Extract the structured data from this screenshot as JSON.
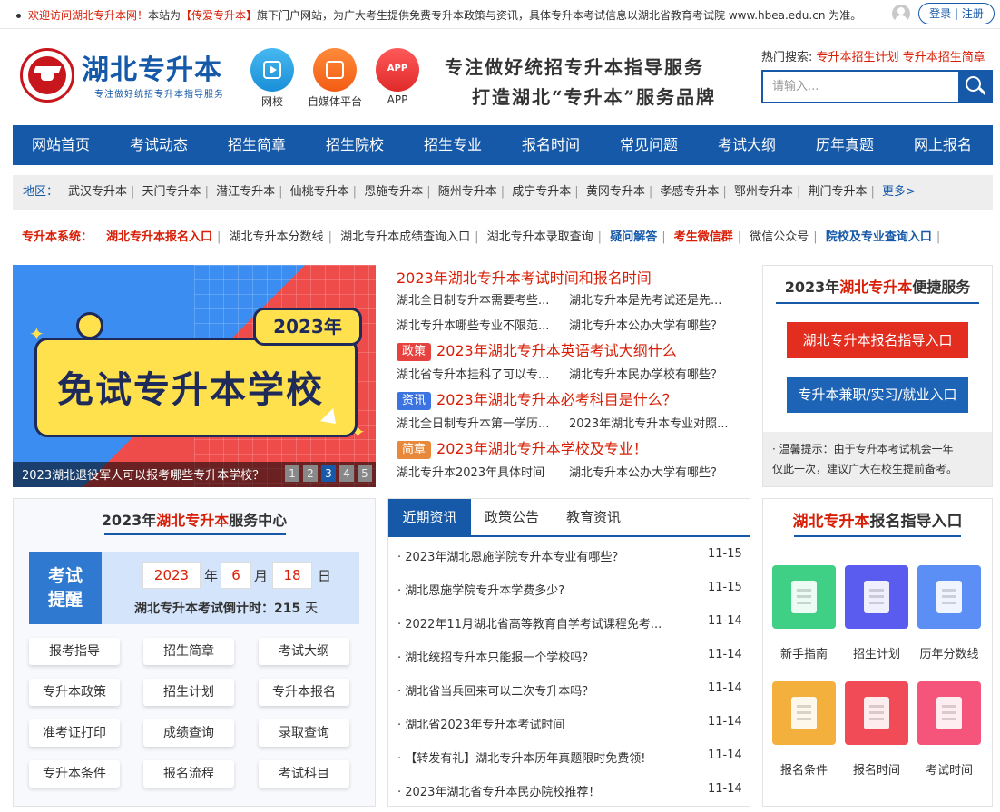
{
  "topbar": {
    "welcome_prefix": "欢迎访问湖北专升本网！",
    "welcome_mid1": "本站为",
    "welcome_brand": "【传爱专升本】",
    "welcome_rest": "旗下门户网站，为广大考生提供免费专升本政策与资讯，具体专升本考试信息以湖北省教育考试院 www.hbea.edu.cn 为准。",
    "login": "登录 | 注册"
  },
  "header": {
    "logo_title": "湖北专升本",
    "logo_subtitle": "专注做好统招专升本指导服务",
    "apps": [
      {
        "label": "网校"
      },
      {
        "label": "自媒体平台"
      },
      {
        "label": "APP",
        "icon_text": "APP"
      }
    ],
    "slogan1": "专注做好统招专升本指导服务",
    "slogan2": "打造湖北“专升本”服务品牌",
    "hot_label": "热门搜索:",
    "hot1": "专升本招生计划",
    "hot2": "专升本招生简章",
    "search_placeholder": "请输入..."
  },
  "nav": [
    "网站首页",
    "考试动态",
    "招生简章",
    "招生院校",
    "招生专业",
    "报名时间",
    "常见问题",
    "考试大纲",
    "历年真题",
    "网上报名"
  ],
  "region": {
    "label": "地区：",
    "items": [
      "武汉专升本",
      "天门专升本",
      "潜江专升本",
      "仙桃专升本",
      "恩施专升本",
      "随州专升本",
      "咸宁专升本",
      "黄冈专升本",
      "孝感专升本",
      "鄂州专升本",
      "荆门专升本"
    ],
    "more": "更多>"
  },
  "system": {
    "label": "专升本系统：",
    "items": [
      {
        "text": "湖北专升本报名入口",
        "style": "red"
      },
      {
        "text": "湖北专升本分数线",
        "style": "norm"
      },
      {
        "text": "湖北专升本成绩查询入口",
        "style": "norm"
      },
      {
        "text": "湖北专升本录取查询",
        "style": "norm"
      },
      {
        "text": "疑问解答",
        "style": "blue"
      },
      {
        "text": "考生微信群",
        "style": "red"
      },
      {
        "text": "微信公众号",
        "style": "norm"
      },
      {
        "text": "院校及专业查询入口",
        "style": "blue"
      }
    ]
  },
  "banner": {
    "year": "2023年",
    "title": "免试专升本学校",
    "caption": "2023湖北退役军人可以报考哪些专升本学校？",
    "pages": [
      "1",
      "2",
      "3",
      "4",
      "5"
    ],
    "active_page": "3"
  },
  "news": {
    "headline": "2023年湖北专升本考试时间和报名时间",
    "rows": [
      {
        "a": "湖北全日制专升本需要考些...",
        "b": "湖北专升本是先考试还是先..."
      },
      {
        "a": "湖北专升本哪些专业不限范...",
        "b": "湖北专升本公办大学有哪些？"
      },
      {
        "tag": "政策",
        "tag_color": "red",
        "head": "2023年湖北专升本英语考试大纲什么"
      },
      {
        "a": "湖北省专升本挂科了可以专...",
        "b": "湖北专升本民办学校有哪些？"
      },
      {
        "tag": "资讯",
        "tag_color": "blue",
        "head": "2023年湖北专升本必考科目是什么？"
      },
      {
        "a": "湖北全日制专升本第一学历...",
        "b": "2023年湖北专升本专业对照..."
      },
      {
        "tag": "简章",
        "tag_color": "orange",
        "head": "2023年湖北专升本学校及专业！"
      },
      {
        "a": "湖北专升本2023年具体时间",
        "b": "湖北专升本公办大学有哪些？"
      }
    ]
  },
  "service": {
    "title_prefix": "2023年",
    "title_brand": "湖北专升本",
    "title_suffix": "便捷服务",
    "btn1": "湖北专升本报名指导入口",
    "btn2": "专升本兼职/实习/就业入口",
    "tip_line1": "· 温馨提示：由于专升本考试机会一年",
    "tip_line2": "仅此一次，建议广大在校生提前备考。"
  },
  "service_center": {
    "title_prefix": "2023年",
    "title_brand": "湖北专升本",
    "title_suffix": "服务中心",
    "reminder_line1": "考试",
    "reminder_line2": "提醒",
    "year": "2023",
    "year_unit": "年",
    "month": "6",
    "month_unit": "月",
    "day": "18",
    "day_unit": "日",
    "countdown_label": "湖北专升本考试倒计时：",
    "countdown_value": "215",
    "countdown_unit": "天",
    "buttons": [
      "报考指导",
      "招生简章",
      "考试大纲",
      "专升本政策",
      "招生计划",
      "专升本报名",
      "准考证打印",
      "成绩查询",
      "录取查询",
      "专升本条件",
      "报名流程",
      "考试科目"
    ]
  },
  "tabs": {
    "labels": [
      "近期资讯",
      "政策公告",
      "教育资讯"
    ],
    "active": "近期资讯",
    "items": [
      {
        "title": "· 2023年湖北恩施学院专升本专业有哪些？",
        "date": "11-15"
      },
      {
        "title": "· 湖北恩施学院专升本学费多少?",
        "date": "11-15"
      },
      {
        "title": "· 2022年11月湖北省高等教育自学考试课程免考...",
        "date": "11-14"
      },
      {
        "title": "· 湖北统招专升本只能报一个学校吗？",
        "date": "11-14"
      },
      {
        "title": "· 湖北省当兵回来可以二次专升本吗？",
        "date": "11-14"
      },
      {
        "title": "· 湖北省2023年专升本考试时间",
        "date": "11-14"
      },
      {
        "title": "· 【转发有礼】湖北专升本历年真题限时免费领!",
        "date": "11-14"
      },
      {
        "title": "· 2023年湖北省专升本民办院校推荐！",
        "date": "11-14"
      }
    ]
  },
  "guide": {
    "title_brand": "湖北专升本",
    "title_suffix": "报名指导入口",
    "tiles": [
      {
        "label": "新手指南",
        "color": "#3fcf85"
      },
      {
        "label": "招生计划",
        "color": "#5a5cf0"
      },
      {
        "label": "历年分数线",
        "color": "#5b8ff5"
      },
      {
        "label": "报名条件",
        "color": "#f4b03c"
      },
      {
        "label": "报名时间",
        "color": "#f14b58"
      },
      {
        "label": "考试时间",
        "color": "#f5557a"
      }
    ]
  }
}
